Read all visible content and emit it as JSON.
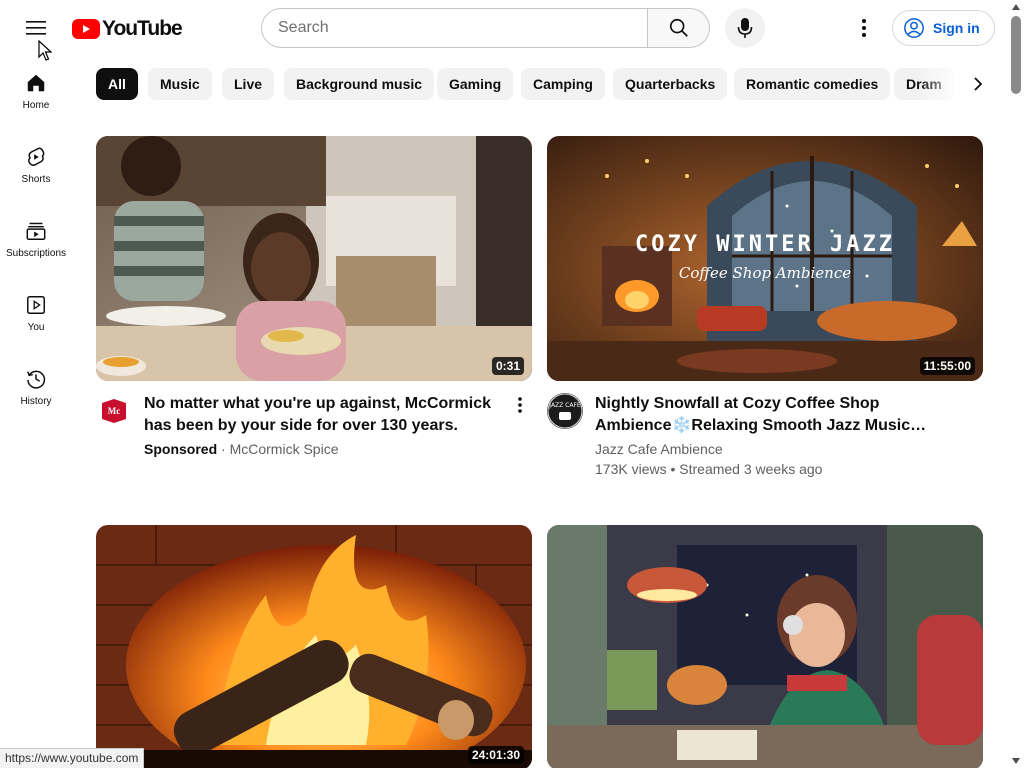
{
  "header": {
    "logo_text": "YouTube",
    "search_placeholder": "Search",
    "signin_label": "Sign in"
  },
  "sidebar": {
    "items": [
      {
        "label": "Home",
        "icon": "home-icon"
      },
      {
        "label": "Shorts",
        "icon": "shorts-icon"
      },
      {
        "label": "Subscriptions",
        "icon": "subscriptions-icon"
      },
      {
        "label": "You",
        "icon": "you-icon"
      },
      {
        "label": "History",
        "icon": "history-icon"
      }
    ]
  },
  "chips": [
    "All",
    "Music",
    "Live",
    "Background music",
    "Gaming",
    "Camping",
    "Quarterbacks",
    "Romantic comedies",
    "Dram"
  ],
  "videos": [
    {
      "title": "No matter what you're up against, McCormick has been by your side for over 130 years.",
      "sponsored_label": "Sponsored",
      "channel": "McCormick Spice",
      "duration": "0:31"
    },
    {
      "title": "Nightly Snowfall at Cozy Coffee Shop Ambience❄️Relaxing Smooth Jazz Music…",
      "channel": "Jazz Cafe Ambience",
      "stats": "173K views • Streamed 3 weeks ago",
      "duration": "11:55:00",
      "thumb_title": "COZY WINTER JAZZ",
      "thumb_subtitle": "Coffee Shop Ambience",
      "avatar_text": "JAZZ CAFE"
    },
    {
      "duration": "24:01:30"
    },
    {
      "duration": ""
    }
  ],
  "status_bar": {
    "url": "https://www.youtube.com"
  },
  "colors": {
    "brand_red": "#ff0000",
    "link_blue": "#065fd4",
    "chip_bg": "#f2f2f2"
  }
}
